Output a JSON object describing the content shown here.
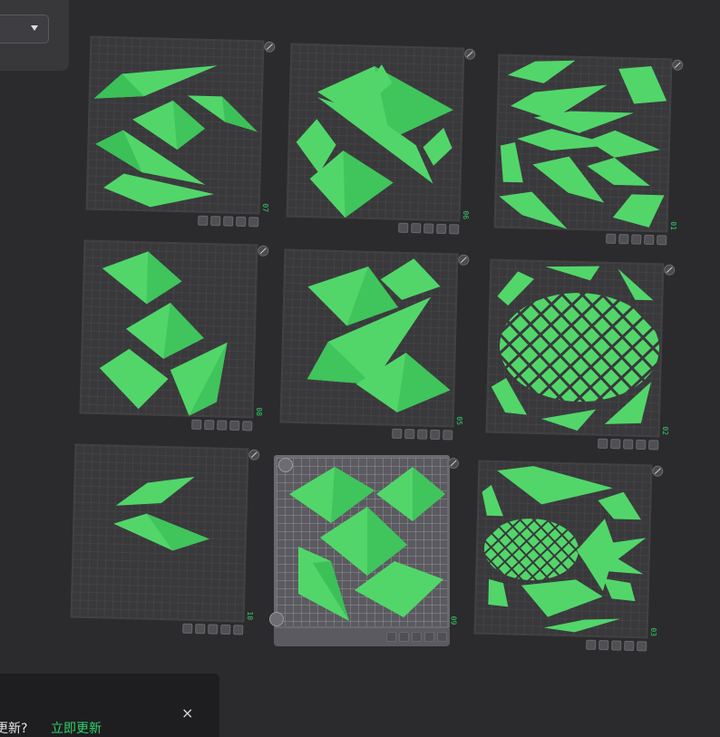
{
  "notice": {
    "text": "更新?",
    "link": "立即更新",
    "close": "×"
  },
  "plates": [
    {
      "num": "07"
    },
    {
      "num": "06"
    },
    {
      "num": "01"
    },
    {
      "num": "08"
    },
    {
      "num": "05"
    },
    {
      "num": "02"
    },
    {
      "num": "10"
    },
    {
      "num": "09"
    },
    {
      "num": "03"
    }
  ],
  "colors": {
    "accent": "#2fd36a",
    "part_fill": "#52d66a",
    "part_dark": "#38b04f"
  }
}
